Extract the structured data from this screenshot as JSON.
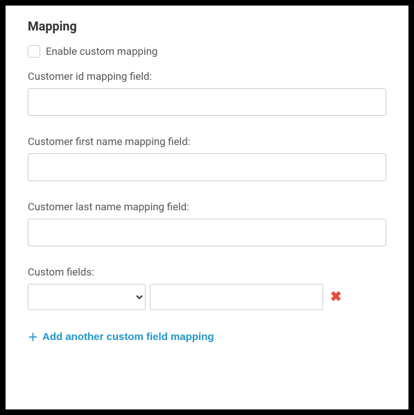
{
  "section": {
    "title": "Mapping"
  },
  "enable": {
    "label": "Enable custom mapping",
    "checked": false
  },
  "fields": {
    "customer_id": {
      "label": "Customer id mapping field:",
      "value": ""
    },
    "first_name": {
      "label": "Customer first name mapping field:",
      "value": ""
    },
    "last_name": {
      "label": "Customer last name mapping field:",
      "value": ""
    }
  },
  "custom": {
    "label": "Custom fields:",
    "rows": [
      {
        "select_value": "",
        "text_value": ""
      }
    ]
  },
  "add_link": {
    "label": "Add another custom field mapping"
  }
}
